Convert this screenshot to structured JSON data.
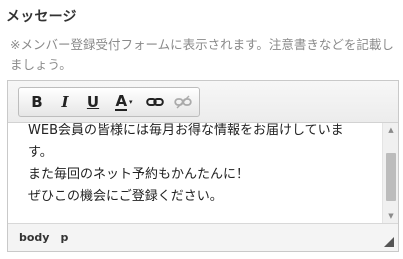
{
  "field": {
    "label": "メッセージ",
    "note": "※メンバー登録受付フォームに表示されます。注意書きなどを記載しましょう。"
  },
  "toolbar": {
    "bold_label": "B",
    "italic_label": "I",
    "underline_label": "U",
    "text_color_label": "A",
    "text_color_caret": "▾",
    "link_icon": "link-icon",
    "unlink_icon": "unlink-icon"
  },
  "editor": {
    "lines": [
      "WEB会員の皆様には毎月お得な情報をお届けしていま",
      "す。",
      "また毎回のネット予約もかんたんに！",
      "ぜひこの機会にご登録ください。"
    ]
  },
  "scrollbar": {
    "up_arrow": "▲",
    "down_arrow": "▼"
  },
  "statusbar": {
    "path": [
      "body",
      "p"
    ]
  }
}
